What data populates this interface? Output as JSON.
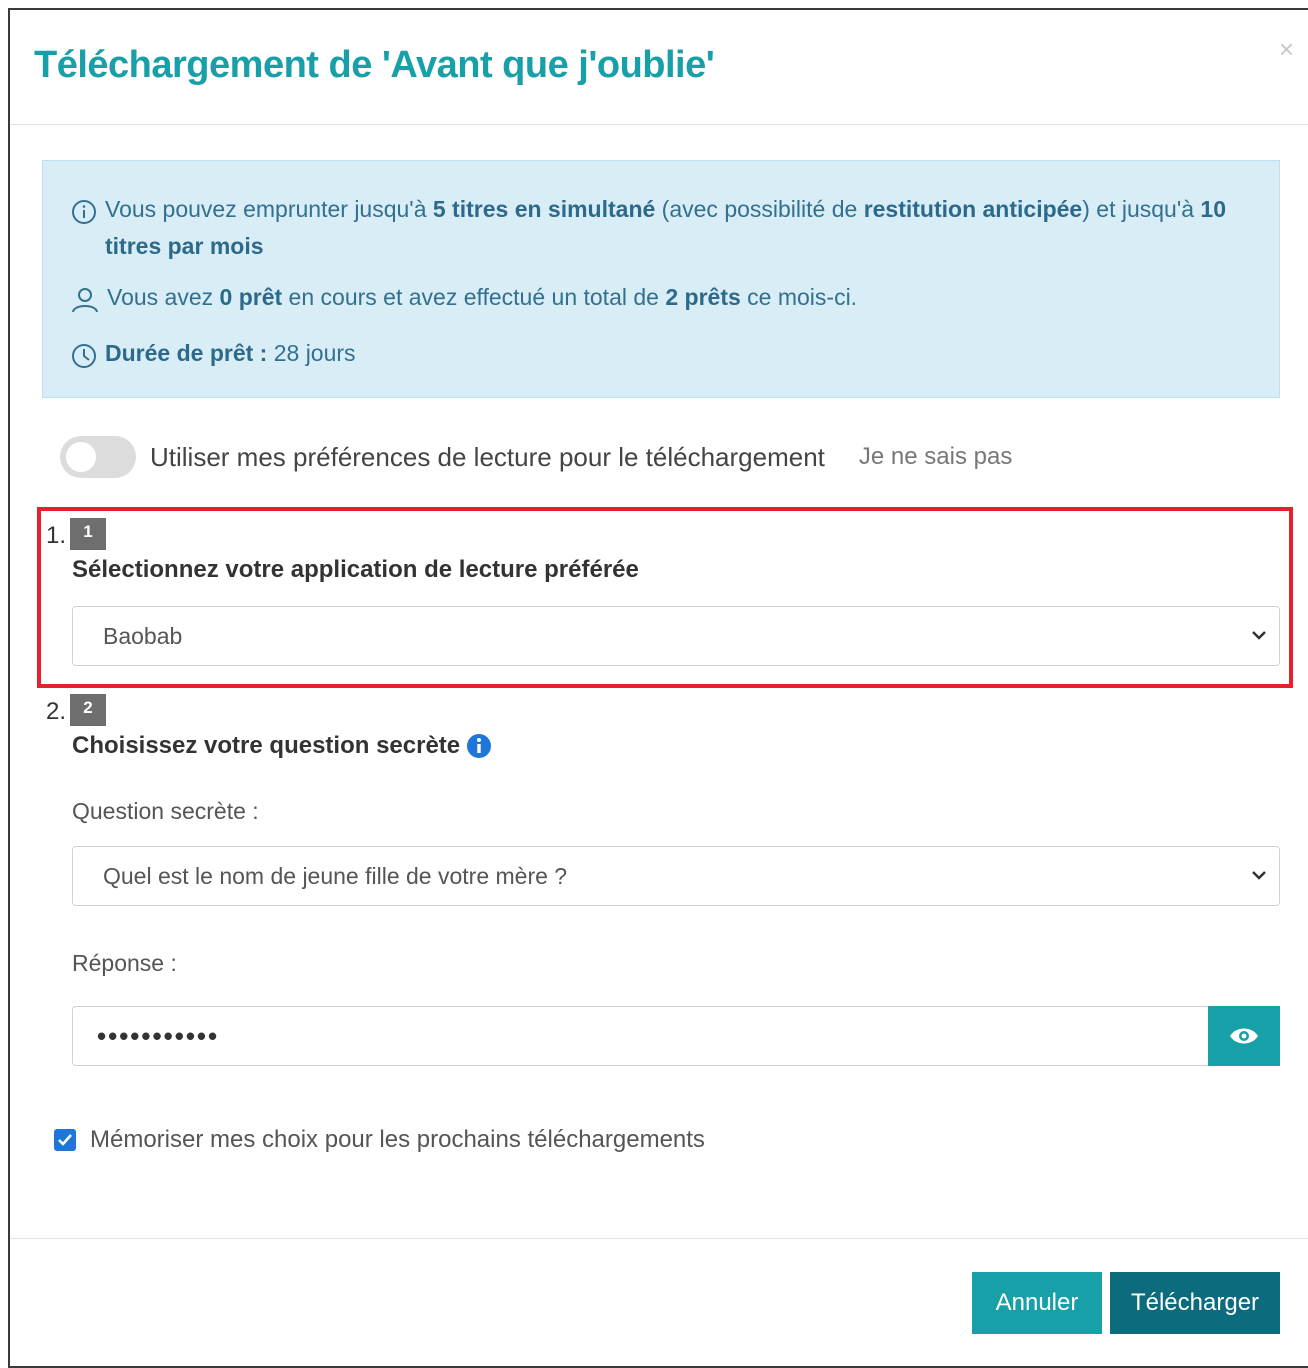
{
  "modal": {
    "title": "Téléchargement de 'Avant que j'oublie'",
    "close_label": "×"
  },
  "info": {
    "line1": {
      "t1": "Vous pouvez emprunter jusqu'à ",
      "b1": "5 titres en simultané",
      "t2": " (avec possibilité de ",
      "b2": "restitution anticipée",
      "t3": ") et jusqu'à ",
      "b3": "10 titres par mois"
    },
    "line2": {
      "t1": "Vous avez ",
      "b1": "0 prêt",
      "t2": " en cours et avez effectué un total de ",
      "b2": "2 prêts",
      "t3": " ce mois-ci."
    },
    "line3": {
      "b1": "Durée de prêt :",
      "t1": " 28 jours"
    }
  },
  "preferences": {
    "toggle_label": "Utiliser mes préférences de lecture pour le téléchargement",
    "help_link": "Je ne sais pas",
    "enabled": false
  },
  "step1": {
    "number": "1.",
    "badge": "1",
    "title": "Sélectionnez votre application de lecture préférée",
    "selected_app": "Baobab"
  },
  "step2": {
    "number": "2.",
    "badge": "2",
    "title": "Choisissez votre question secrète",
    "question_label": "Question secrète :",
    "question_value": "Quel est le nom de jeune fille de votre mère ?",
    "answer_label": "Réponse :",
    "answer_masked": "•••••••••••"
  },
  "remember": {
    "label": "Mémoriser mes choix pour les prochains téléchargements",
    "checked": true
  },
  "footer": {
    "cancel_label": "Annuler",
    "download_label": "Télécharger"
  },
  "colors": {
    "accent": "#17a0a8",
    "dark_accent": "#0d6b7e",
    "info_bg": "#d9edf7",
    "info_text": "#31708f",
    "highlight": "#e8202d",
    "checkbox": "#1e77d8"
  }
}
